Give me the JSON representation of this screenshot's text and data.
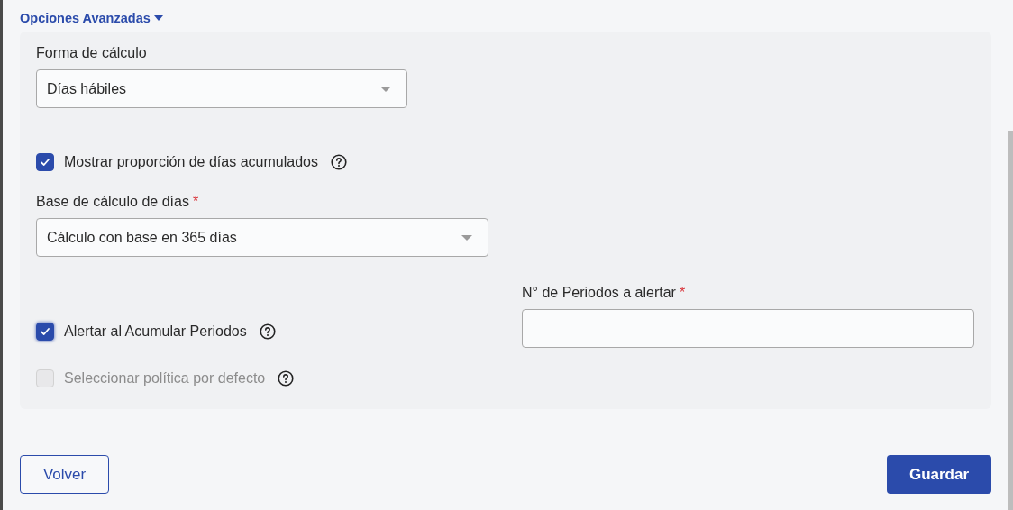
{
  "section": {
    "title": "Opciones Avanzadas",
    "expanded": true
  },
  "calc_method": {
    "label": "Forma de cálculo",
    "value": "Días hábiles"
  },
  "show_ratio": {
    "label": "Mostrar proporción de días acumulados",
    "checked": true,
    "disabled": false,
    "help": true
  },
  "day_base": {
    "label": "Base de cálculo de días",
    "required_mark": "*",
    "value": "Cálculo con base en 365 días"
  },
  "alert_periods": {
    "label": "Alertar al Acumular Periodos",
    "checked": true,
    "disabled": false,
    "help": true
  },
  "default_policy": {
    "label": "Seleccionar política por defecto",
    "checked": false,
    "disabled": true,
    "help": true
  },
  "periods_field": {
    "label": "N° de Periodos a alertar",
    "required_mark": "*"
  },
  "buttons": [
    {
      "label": "Volver",
      "kind": "secondary"
    },
    {
      "label": "Guardar",
      "kind": "primary"
    }
  ]
}
